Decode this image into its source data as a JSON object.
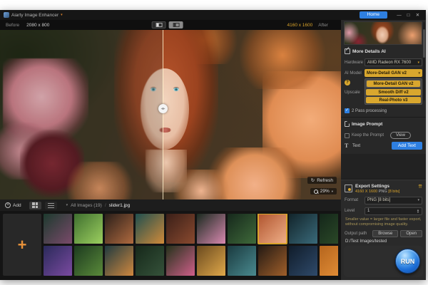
{
  "window": {
    "title": "Aiarty Image Enhancer",
    "home": "Home",
    "minimize": "—",
    "maximize": "□",
    "close": "✕"
  },
  "viewer": {
    "before_label": "Before",
    "before_size": "2080 x 800",
    "after_size": "4160 x 1600",
    "after_label": "After",
    "refresh": "Refresh",
    "zoom": "29%",
    "handle_glyph": "◂▸"
  },
  "panel": {
    "more_details": {
      "title": "More Details AI",
      "hardware_label": "Hardware",
      "hardware_value": "AMD Radeon RX 7600",
      "ai_model_label": "AI Model",
      "ai_model_value": "More-Detail GAN v2",
      "options": [
        "More-Detail GAN v2",
        "Smooth Diff v2",
        "Real-Photo v3"
      ],
      "help_glyph": "?",
      "upscale_label": "Upscale",
      "two_pass": "2 Pass processing",
      "check_glyph": "✓"
    },
    "prompt": {
      "title": "Image Prompt",
      "keep_prompt": "Keep the Prompt",
      "view": "View",
      "text_label": "Text",
      "text_glyph": "T",
      "add_text": "Add Text"
    },
    "export": {
      "title": "Export Settings",
      "summary_size": "4160 X 1600",
      "summary_format": "PNG",
      "summary_depth": "[8 bits]",
      "collapse_glyph": "⇈",
      "format_label": "Format",
      "format_value": "PNG   [8 bits]",
      "level_label": "Level",
      "level_value": "1",
      "hint": "Smaller value = larger file and faster export, without compromising image quality.",
      "output_label": "Output path",
      "browse": "Browse",
      "open": "Open",
      "path": "D:/Test Images/tested",
      "run": "RUN"
    }
  },
  "bottom": {
    "add": "Add",
    "filter": "All Images (19)",
    "sep": "/",
    "file": "slider1.jpg"
  },
  "colors": {
    "accent_yellow": "#d9a32a",
    "accent_blue": "#2e7fe0"
  },
  "thumbnails": {
    "row1": [
      {
        "g": [
          "#1d3a2e",
          "#7a4a6a"
        ],
        "sel": false
      },
      {
        "g": [
          "#3f6f2f",
          "#9ccf5f"
        ],
        "sel": false
      },
      {
        "g": [
          "#2a1f1a",
          "#b06a3f"
        ],
        "sel": false
      },
      {
        "g": [
          "#1f4f4f",
          "#d08a3a"
        ],
        "sel": false
      },
      {
        "g": [
          "#3a1f18",
          "#8a4a2f"
        ],
        "sel": false
      },
      {
        "g": [
          "#1a2a1f",
          "#d989b0"
        ],
        "sel": false
      },
      {
        "g": [
          "#16281c",
          "#3f6a3a"
        ],
        "sel": false
      },
      {
        "g": [
          "#b0542e",
          "#f0b089"
        ],
        "sel": true
      },
      {
        "g": [
          "#12242a",
          "#3a6a7a"
        ],
        "sel": false
      },
      {
        "g": [
          "#14261a",
          "#2f4f2a"
        ],
        "sel": false
      }
    ],
    "row2": [
      {
        "g": [
          "#2a2a5a",
          "#7a4aa0"
        ],
        "sel": false
      },
      {
        "g": [
          "#1c3a1f",
          "#5a8a3a"
        ],
        "sel": false
      },
      {
        "g": [
          "#1f3a3f",
          "#d0883f"
        ],
        "sel": false
      },
      {
        "g": [
          "#16281a",
          "#35523a"
        ],
        "sel": false
      },
      {
        "g": [
          "#24321a",
          "#cf5f8a"
        ],
        "sel": false
      },
      {
        "g": [
          "#6a4a1f",
          "#e0a84a"
        ],
        "sel": false
      },
      {
        "g": [
          "#1a3a3f",
          "#4a8a8f"
        ],
        "sel": false
      },
      {
        "g": [
          "#241a14",
          "#a05f2a"
        ],
        "sel": false
      },
      {
        "g": [
          "#101c2a",
          "#2f4a6a"
        ],
        "sel": false
      },
      {
        "g": [
          "#b5651d",
          "#e8933a"
        ],
        "sel": false
      }
    ]
  }
}
